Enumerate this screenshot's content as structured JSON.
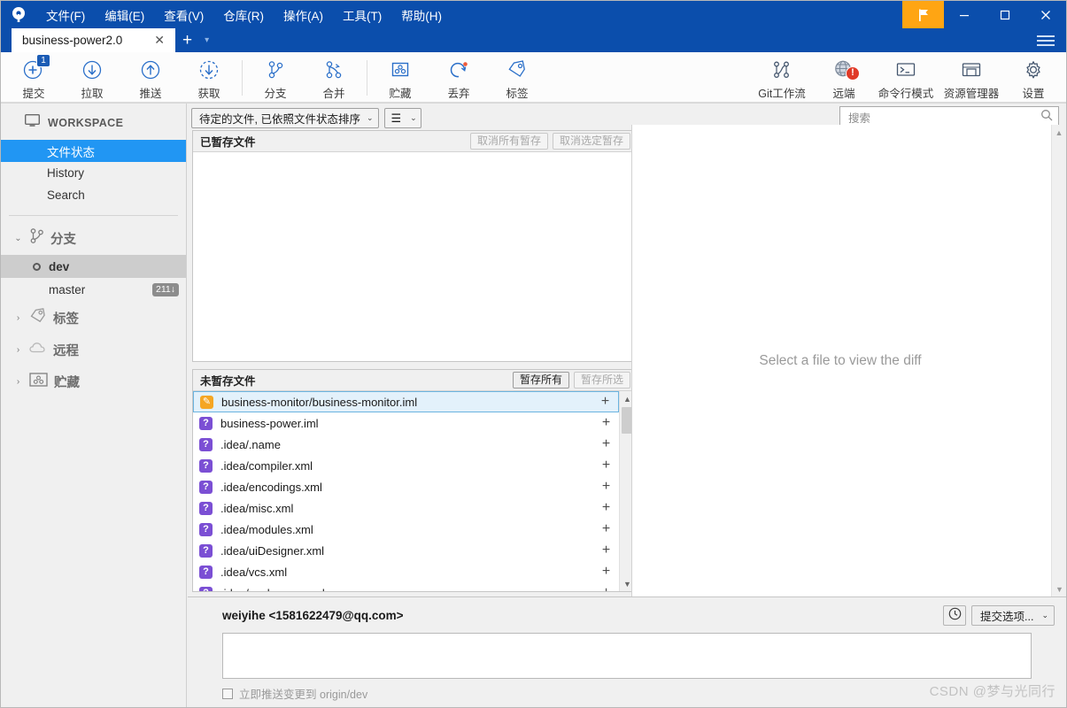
{
  "window": {
    "menus": [
      {
        "label": "文件(F)",
        "name": "menu-file"
      },
      {
        "label": "编辑(E)",
        "name": "menu-edit"
      },
      {
        "label": "查看(V)",
        "name": "menu-view"
      },
      {
        "label": "仓库(R)",
        "name": "menu-repository"
      },
      {
        "label": "操作(A)",
        "name": "menu-actions"
      },
      {
        "label": "工具(T)",
        "name": "menu-tools"
      },
      {
        "label": "帮助(H)",
        "name": "menu-help"
      }
    ],
    "minimize": "—",
    "maximize": "□",
    "close": "✕",
    "titlebar_color": "#0b4eac",
    "flag_color": "#ffa513"
  },
  "tabs": {
    "active_tab": "business-power2.0",
    "close_glyph": "✕",
    "add_glyph": "+",
    "caret_glyph": "▾"
  },
  "toolbar": {
    "left": [
      {
        "label": "提交",
        "icon": "commit-plus-icon",
        "badge": "1"
      },
      {
        "label": "拉取",
        "icon": "pull-down-arrow-icon"
      },
      {
        "label": "推送",
        "icon": "push-up-arrow-icon"
      },
      {
        "label": "获取",
        "icon": "fetch-dashed-arrow-icon"
      },
      {
        "label": "分支",
        "icon": "branch-icon"
      },
      {
        "label": "合并",
        "icon": "merge-icon"
      },
      {
        "label": "贮藏",
        "icon": "stash-icon"
      },
      {
        "label": "丢弃",
        "icon": "discard-revert-icon"
      },
      {
        "label": "标签",
        "icon": "tag-icon"
      }
    ],
    "right": [
      {
        "label": "Git工作流",
        "icon": "gitflow-icon"
      },
      {
        "label": "远端",
        "icon": "remote-globe-icon",
        "warn": "!"
      },
      {
        "label": "命令行模式",
        "icon": "terminal-icon"
      },
      {
        "label": "资源管理器",
        "icon": "explorer-icon"
      },
      {
        "label": "设置",
        "icon": "gear-icon"
      }
    ]
  },
  "sidebar": {
    "workspace_title": "WORKSPACE",
    "nav": [
      {
        "label": "文件状态",
        "active": true
      },
      {
        "label": "History",
        "active": false
      },
      {
        "label": "Search",
        "active": false
      }
    ],
    "sections": [
      {
        "title": "分支",
        "icon": "branch-icon",
        "expanded": true
      },
      {
        "title": "标签",
        "icon": "tag-icon",
        "expanded": false
      },
      {
        "title": "远程",
        "icon": "cloud-icon",
        "expanded": false
      },
      {
        "title": "贮藏",
        "icon": "stash-icon",
        "expanded": false
      }
    ],
    "branches": [
      {
        "name": "dev",
        "current": true,
        "badge": ""
      },
      {
        "name": "master",
        "current": false,
        "badge": "211↓"
      }
    ],
    "caret_expanded": "⌄",
    "caret_collapsed": "›"
  },
  "filterbar": {
    "sort_label": "待定的文件, 已依照文件状态排序",
    "caret": "⌄",
    "view_icon": "list-view-icon",
    "view_glyph": "☰"
  },
  "search": {
    "placeholder": "搜索",
    "icon": "search-icon"
  },
  "staged": {
    "title": "已暂存文件",
    "unstage_all_label": "取消所有暂存",
    "unstage_selected_label": "取消选定暂存",
    "files": []
  },
  "unstaged": {
    "title": "未暂存文件",
    "stage_all_label": "暂存所有",
    "stage_selected_label": "暂存所选",
    "files": [
      {
        "name": "business-monitor/business-monitor.iml",
        "status": "modified",
        "glyph": "✎",
        "selected": true
      },
      {
        "name": "business-power.iml",
        "status": "untracked",
        "glyph": "?",
        "selected": false
      },
      {
        "name": ".idea/.name",
        "status": "untracked",
        "glyph": "?",
        "selected": false
      },
      {
        "name": ".idea/compiler.xml",
        "status": "untracked",
        "glyph": "?",
        "selected": false
      },
      {
        "name": ".idea/encodings.xml",
        "status": "untracked",
        "glyph": "?",
        "selected": false
      },
      {
        "name": ".idea/misc.xml",
        "status": "untracked",
        "glyph": "?",
        "selected": false
      },
      {
        "name": ".idea/modules.xml",
        "status": "untracked",
        "glyph": "?",
        "selected": false
      },
      {
        "name": ".idea/uiDesigner.xml",
        "status": "untracked",
        "glyph": "?",
        "selected": false
      },
      {
        "name": ".idea/vcs.xml",
        "status": "untracked",
        "glyph": "?",
        "selected": false
      },
      {
        "name": ".idea/workspace.xml",
        "status": "untracked",
        "glyph": "?",
        "selected": false
      }
    ],
    "add_glyph": "+"
  },
  "diff": {
    "placeholder": "Select a file to view the diff"
  },
  "commit": {
    "author": "weiyihe <1581622479@qq.com>",
    "message": "",
    "history_icon": "clock-icon",
    "options_label": "提交选项...",
    "options_caret": "⌄",
    "push_checkbox_label": "立即推送变更到",
    "push_target": "origin/dev",
    "push_checked": false
  },
  "watermark": {
    "text": "CSDN @梦与光同行"
  }
}
